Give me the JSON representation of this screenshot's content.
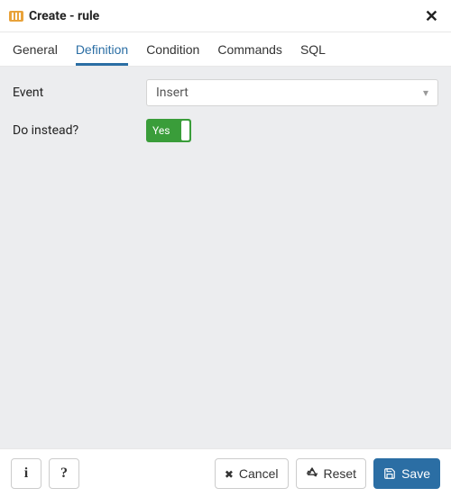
{
  "header": {
    "title": "Create - rule"
  },
  "tabs": [
    {
      "label": "General"
    },
    {
      "label": "Definition",
      "active": true
    },
    {
      "label": "Condition"
    },
    {
      "label": "Commands"
    },
    {
      "label": "SQL"
    }
  ],
  "form": {
    "event_label": "Event",
    "event_value": "Insert",
    "do_instead_label": "Do instead?",
    "do_instead_value": "Yes"
  },
  "footer": {
    "cancel_label": "Cancel",
    "reset_label": "Reset",
    "save_label": "Save"
  }
}
